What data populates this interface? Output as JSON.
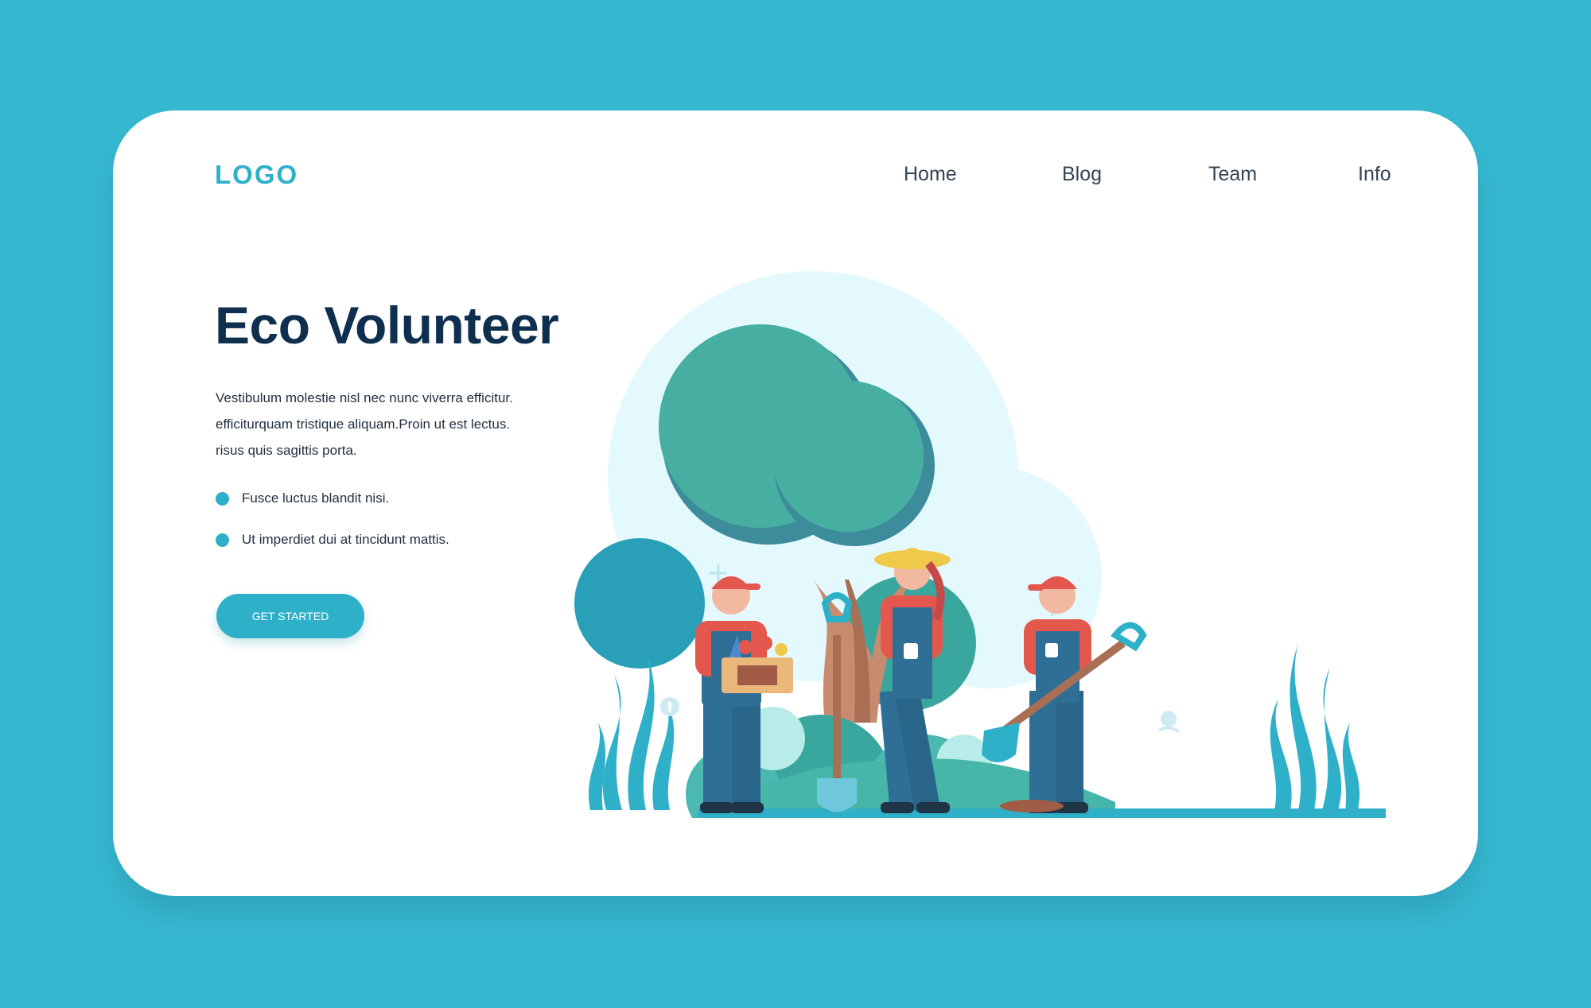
{
  "header": {
    "logo": "LOGO",
    "nav": [
      {
        "label": "Home"
      },
      {
        "label": "Blog"
      },
      {
        "label": "Team"
      },
      {
        "label": "Info"
      }
    ]
  },
  "hero": {
    "title": "Eco Volunteer",
    "description_lines": [
      "Vestibulum molestie nisl nec nunc viverra efficitur.",
      "efficiturquam tristique aliquam.Proin ut est lectus.",
      "risus quis sagittis porta."
    ],
    "bullets": [
      {
        "text": "Fusce luctus blandit nisi."
      },
      {
        "text": "Ut imperdiet dui at tincidunt mattis."
      }
    ],
    "cta_label": "GET STARTED"
  },
  "colors": {
    "page_background": "#36b8d0",
    "accent": "#2fb0c9",
    "title_text": "#0f2f4f",
    "card_background": "#ffffff",
    "tree_foliage": "#3aa79f",
    "overalls": "#2f6f96",
    "cap": "#e4574d"
  },
  "illustration": {
    "icons": [
      "tree-icon",
      "volunteer-figure-icon",
      "shovel-icon",
      "plant-box-icon",
      "seaweed-icon"
    ]
  }
}
